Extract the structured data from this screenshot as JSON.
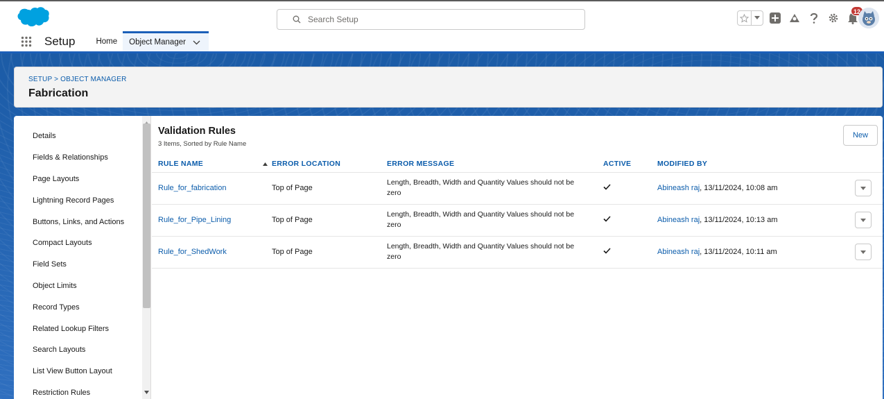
{
  "header": {
    "search_placeholder": "Search Setup",
    "notification_count": "12",
    "brand_color": "#00a1e0"
  },
  "nav": {
    "app_name": "Setup",
    "tabs": [
      {
        "label": "Home"
      },
      {
        "label": "Object Manager"
      }
    ]
  },
  "page": {
    "breadcrumb": "SETUP > OBJECT MANAGER",
    "title": "Fabrication"
  },
  "sidebar": {
    "items": [
      {
        "label": "Details"
      },
      {
        "label": "Fields & Relationships"
      },
      {
        "label": "Page Layouts"
      },
      {
        "label": "Lightning Record Pages"
      },
      {
        "label": "Buttons, Links, and Actions"
      },
      {
        "label": "Compact Layouts"
      },
      {
        "label": "Field Sets"
      },
      {
        "label": "Object Limits"
      },
      {
        "label": "Record Types"
      },
      {
        "label": "Related Lookup Filters"
      },
      {
        "label": "Search Layouts"
      },
      {
        "label": "List View Button Layout"
      },
      {
        "label": "Restriction Rules"
      }
    ]
  },
  "rules": {
    "title": "Validation Rules",
    "subtitle": "3 Items, Sorted by Rule Name",
    "new_label": "New",
    "columns": {
      "rule_name": "RULE NAME",
      "error_location": "ERROR LOCATION",
      "error_message": "ERROR MESSAGE",
      "active": "ACTIVE",
      "modified_by": "MODIFIED BY"
    },
    "rows": [
      {
        "name": "Rule_for_fabrication",
        "location": "Top of Page",
        "message": "Length, Breadth, Width and Quantity Values should not be zero",
        "active": true,
        "modifier": "Abineash raj",
        "date": ", 13/11/2024, 10:08 am"
      },
      {
        "name": "Rule_for_Pipe_Lining",
        "location": "Top of Page",
        "message": "Length, Breadth, Width and Quantity Values should not be zero",
        "active": true,
        "modifier": "Abineash raj",
        "date": ", 13/11/2024, 10:13 am"
      },
      {
        "name": "Rule_for_ShedWork",
        "location": "Top of Page",
        "message": "Length, Breadth, Width and Quantity Values should not be zero",
        "active": true,
        "modifier": "Abineash raj",
        "date": ", 13/11/2024, 10:11 am"
      }
    ]
  }
}
